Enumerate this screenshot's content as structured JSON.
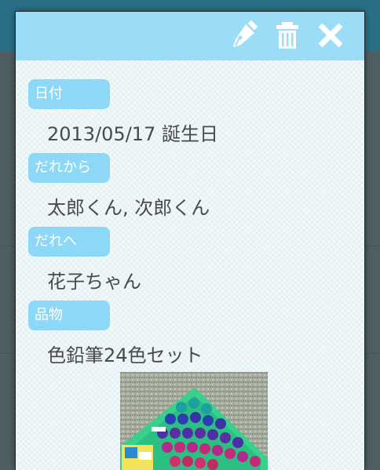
{
  "dialog": {
    "actions": {
      "edit_icon": "pen-icon",
      "delete_icon": "trash-icon",
      "close_icon": "close-icon"
    },
    "fields": [
      {
        "label": "日付",
        "value": "2013/05/17 誕生日"
      },
      {
        "label": "だれから",
        "value": "太郎くん, 次郎くん"
      },
      {
        "label": "だれへ",
        "value": "花子ちゃん"
      },
      {
        "label": "品物",
        "value": "色鉛筆24色セット"
      }
    ],
    "photo": {
      "description_icon": "gift-photo"
    }
  },
  "colors": {
    "header": "#9bdcf6",
    "label_bg": "#8ed8f7",
    "label_text": "#ffffff",
    "value_text": "#4a4a4a"
  }
}
